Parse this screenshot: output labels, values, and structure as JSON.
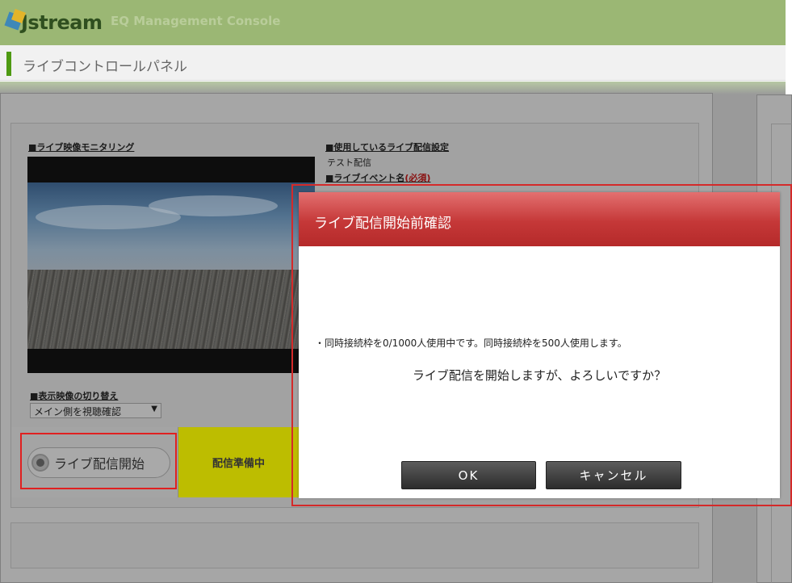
{
  "header": {
    "logo_text": "Jstream",
    "console_title": "EQ Management Console",
    "page_title": "ライブコントロールパネル"
  },
  "monitor": {
    "label": "■ライブ映像モニタリング",
    "switch_label": "■表示映像の切り替え",
    "switch_value": "メイン側を視聴確認"
  },
  "settings": {
    "using_label": "■使用しているライブ配信設定",
    "using_value": "テスト配信",
    "event_label": "■ライブイベント名",
    "event_required": "(必須)"
  },
  "controls": {
    "start_button": "ライブ配信開始",
    "status": "配信準備中"
  },
  "dialog": {
    "title": "ライブ配信開始前確認",
    "line1": "・同時接続枠を0/1000人使用中です。同時接続枠を500人使用します。",
    "line2": "ライブ配信を開始しますが、よろしいですか？",
    "ok_label": "OK",
    "cancel_label": "キャンセル"
  },
  "colors": {
    "header_green": "#9bb774",
    "accent_green": "#4e9a12",
    "dialog_header": "#c53838",
    "status_yellow": "#bdbd00",
    "highlight_red": "#e02020"
  },
  "icons": [
    "jstream-logo-icon",
    "record-dot-icon",
    "dropdown-arrow-icon"
  ]
}
